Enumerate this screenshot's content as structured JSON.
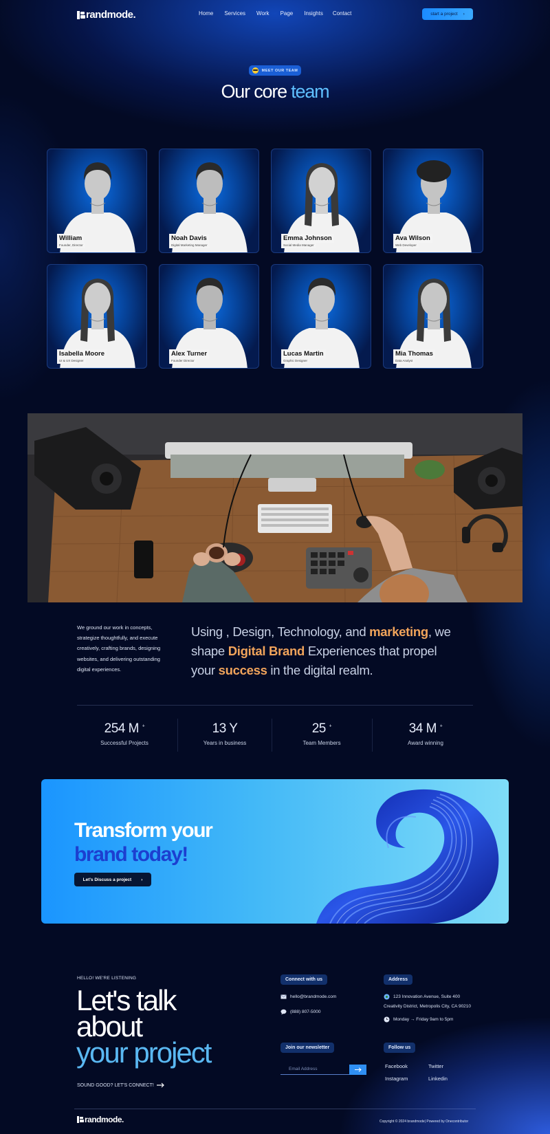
{
  "brand": {
    "name": "randmode."
  },
  "nav": [
    "Home",
    "Services",
    "Work",
    "Page",
    "Insights",
    "Contact"
  ],
  "header_cta": "start a project",
  "team": {
    "badge": "MEET OUR TEAM",
    "title_a": "Our core",
    "title_b": "team",
    "members": [
      {
        "name": "William",
        "role": "Founder, Director",
        "hair": "short",
        "skin": "#c9c9c9"
      },
      {
        "name": "Noah Davis",
        "role": "Digital Marketing Manager",
        "hair": "short",
        "skin": "#bdbdbd"
      },
      {
        "name": "Emma Johnson",
        "role": "Social Media Manager",
        "hair": "long",
        "skin": "#d2d2d2"
      },
      {
        "name": "Ava Wilson",
        "role": "Web Developer",
        "hair": "curly",
        "skin": "#c4c4c4"
      },
      {
        "name": "Isabella Moore",
        "role": "UI & UX Designer",
        "hair": "long",
        "skin": "#cdcdcd"
      },
      {
        "name": "Alex Turner",
        "role": "Founder Director",
        "hair": "short",
        "skin": "#b7b7b7"
      },
      {
        "name": "Lucas Martin",
        "role": "Graphic Designer",
        "hair": "short",
        "skin": "#c8c8c8"
      },
      {
        "name": "Mia Thomas",
        "role": "Data Analyst",
        "hair": "long",
        "skin": "#c6c6c6"
      }
    ]
  },
  "mission": {
    "left_text": "We ground our work in concepts, strategize thoughtfully, and execute creatively, crafting brands, designing websites, and delivering outstanding digital experiences.",
    "p1": "Using , Design, Technology, and ",
    "h1": "marketing",
    "p2": ", we shape ",
    "h2": "Digital Brand",
    "p3": " Experiences that propel your ",
    "h3": "success",
    "p4": " in the digital realm."
  },
  "stats": [
    {
      "value": "254 M",
      "plus": "+",
      "label": "Successful Projects"
    },
    {
      "value": "13 Y",
      "plus": "",
      "label": "Years in business"
    },
    {
      "value": "25",
      "plus": "+",
      "label": "Team Members"
    },
    {
      "value": "34 M",
      "plus": "+",
      "label": "Award winning"
    }
  ],
  "banner": {
    "line1": "Transform your",
    "line2": "brand today!",
    "button": "Let's Discuss a project"
  },
  "footer": {
    "eyebrow": "HELLO! WE'RE LISTENING",
    "big1": "Let's talk",
    "big2": "about",
    "big3": "your project",
    "sub": "SOUND GOOD? LET'S CONNECT!",
    "connect_title": "Connect with us",
    "email": "hello@brandmode.com",
    "phone": "(888) 807-5000",
    "address_title": "Address",
    "address1": "123 Innovation Avenue, Suite 400",
    "address2": "Creativity District, Metropolis City, CA 90210",
    "hours": "Monday → Friday 9am to 5pm",
    "newsletter_title": "Join our newsletter",
    "newsletter_placeholder": "Email Address",
    "follow_title": "Follow us",
    "socials": [
      "Facebook",
      "Twitter",
      "Instagram",
      "Linkedin"
    ],
    "copyright": "Copyright © 2024 brandmode| Powered by Onecontributor"
  },
  "colors": {
    "accent_blue": "#5fc0ff",
    "accent_orange": "#f1a45b",
    "banner_dark": "#1c3fd0"
  }
}
